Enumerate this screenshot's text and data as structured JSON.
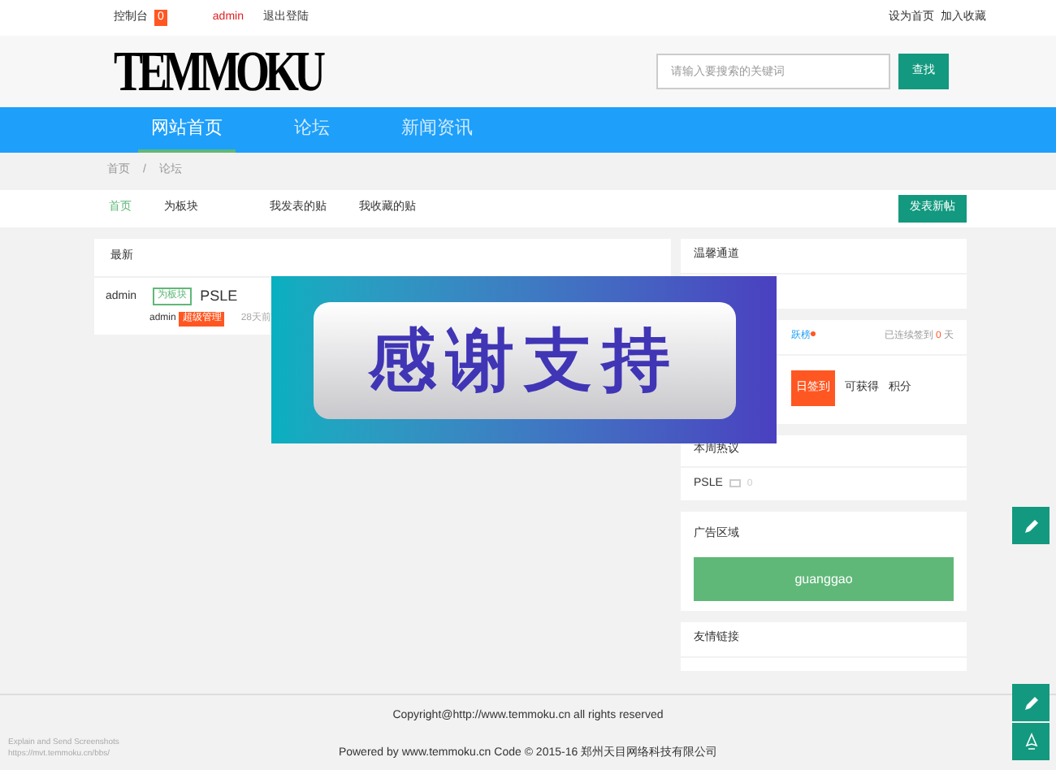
{
  "topbar": {
    "console": "控制台",
    "console_badge": "0",
    "user": "admin",
    "logout": "退出登陆",
    "set_home": "设为首页",
    "bookmark": "加入收藏"
  },
  "header": {
    "logo": "TEMMOKU",
    "search": {
      "placeholder": "请输入要搜索的关键词"
    },
    "search_button": "查找"
  },
  "nav": [
    {
      "label": "网站首页",
      "selected": true
    },
    {
      "label": "论坛",
      "selected": false
    },
    {
      "label": "新闻资讯",
      "selected": false
    }
  ],
  "breadcrumb": [
    "首页",
    "/",
    "论坛"
  ],
  "subnav": {
    "tabs": [
      {
        "label": "首页",
        "selected": true
      },
      {
        "label": "为板块",
        "selected": false
      },
      {
        "label": "我发表的贴",
        "selected": false
      },
      {
        "label": "我收藏的贴",
        "selected": false
      }
    ],
    "new_post": "发表新帖"
  },
  "latest": {
    "title": "最新",
    "posts": [
      {
        "author": "admin",
        "tag": "为板块",
        "title": "PSLE",
        "poster": "admin",
        "role": "超级管理",
        "time": "28天前"
      }
    ]
  },
  "sidebar": {
    "channel": "温馨通道",
    "rank": "跃榜",
    "streak_prefix": "已连续签到",
    "streak_days": "0",
    "streak_suffix": "天",
    "sign_button": "日签到",
    "earn": "可获得",
    "points": "积分",
    "hot_title": "本周热议",
    "hot": [
      {
        "title": "PSLE",
        "count": "0"
      }
    ],
    "ad_title": "广告区域",
    "ad": "guanggao",
    "links_title": "友情链接"
  },
  "overlay": {
    "text": "感谢支持"
  },
  "footer": {
    "copyright": "Copyright@http://www.temmoku.cn all rights reserved",
    "powered": "Powered by www.temmoku.cn Code © 2015-16 郑州天目网络科技有限公司",
    "side_note": [
      "Explain and Send Screenshots",
      "https://mvt.temmoku.cn/bbs/"
    ]
  }
}
